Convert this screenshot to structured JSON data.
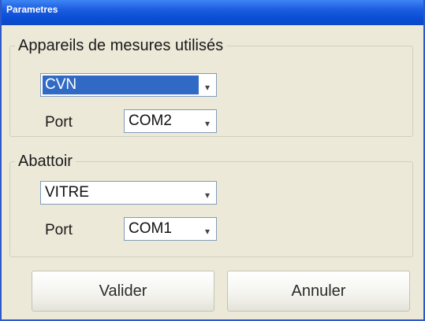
{
  "window": {
    "title": "Parametres"
  },
  "groups": {
    "devices": {
      "legend": "Appareils de mesures utilisés",
      "device_value": "CVN",
      "port_label": "Port",
      "port_value": "COM2"
    },
    "slaughterhouse": {
      "legend": "Abattoir",
      "value": "VITRE",
      "port_label": "Port",
      "port_value": "COM1"
    }
  },
  "buttons": {
    "validate_label": "Valider",
    "cancel_label": "Annuler"
  },
  "colors": {
    "titlebar": "#0b4fd6",
    "selection": "#316ac5",
    "dialog_background": "#ece9d8"
  },
  "icons": {
    "dropdown": "chevron-down-icon"
  }
}
